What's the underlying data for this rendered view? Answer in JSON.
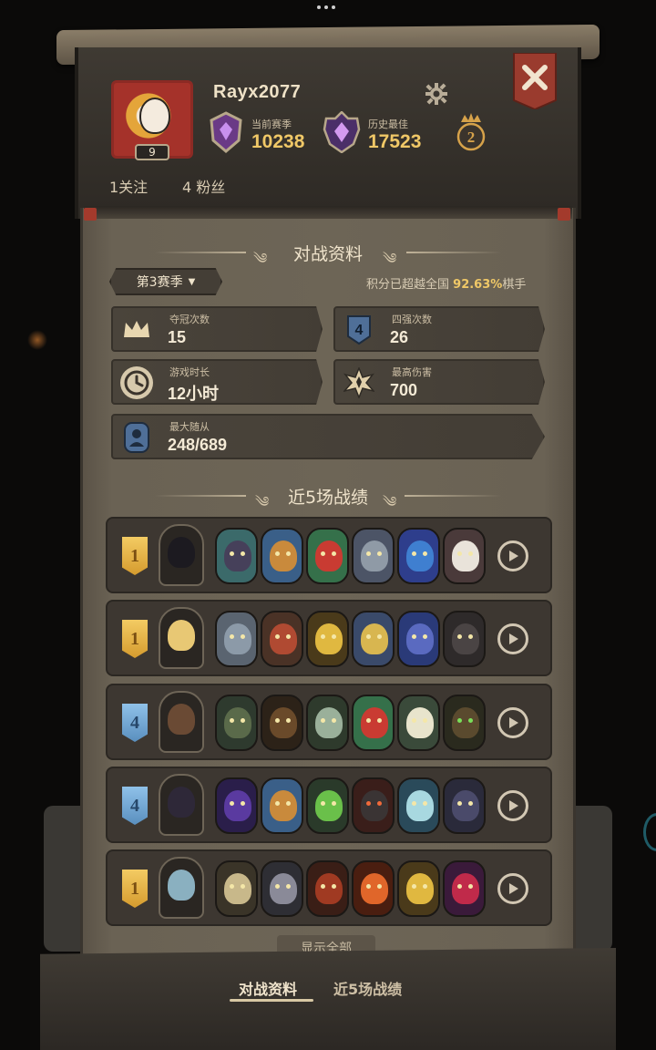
{
  "profile": {
    "username": "Rayx2077",
    "level": "9",
    "current_season_label": "当前赛季",
    "current_season_score": "10238",
    "best_label": "历史最佳",
    "best_score": "17523",
    "crown_count": "2",
    "following": "1关注",
    "followers": "4 粉丝"
  },
  "battle_data": {
    "title": "对战资料",
    "season_select": "第3赛季",
    "rank_prefix": "积分已超越全国",
    "rank_percent": "92.63%",
    "rank_suffix": "棋手",
    "stats": [
      {
        "label": "夺冠次数",
        "value": "15"
      },
      {
        "label": "四强次数",
        "value": "26"
      },
      {
        "label": "游戏时长",
        "value": "12小时"
      },
      {
        "label": "最高伤害",
        "value": "700"
      },
      {
        "label": "最大随从",
        "value": "248/689"
      }
    ],
    "top4_icon_text": "4"
  },
  "recent": {
    "title": "近5场战绩",
    "matches": [
      {
        "rank": "1",
        "tier": "gold"
      },
      {
        "rank": "1",
        "tier": "gold"
      },
      {
        "rank": "4",
        "tier": "blue"
      },
      {
        "rank": "4",
        "tier": "blue"
      },
      {
        "rank": "1",
        "tier": "gold"
      }
    ],
    "show_all": "显示全部"
  },
  "tabs": {
    "active": "对战资料",
    "inactive": "近5场战绩"
  },
  "colors": {
    "accent_gold": "#f0c867",
    "close_red": "#9a3b2e",
    "parchment": "#6d6556"
  }
}
